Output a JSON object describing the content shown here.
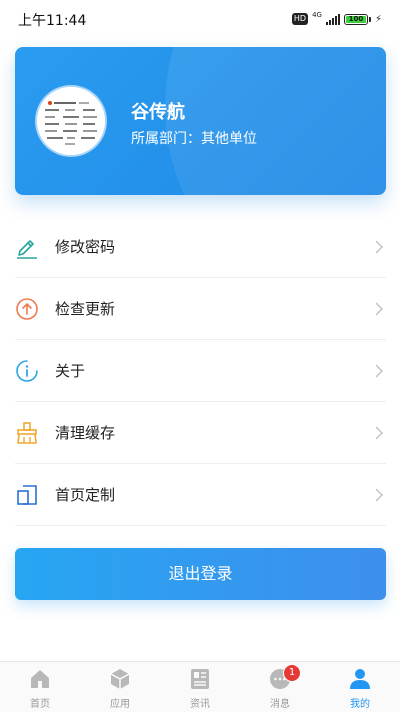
{
  "status_bar": {
    "time": "上午11:44",
    "hd": "HD",
    "network": "4G",
    "battery": "100"
  },
  "profile": {
    "name": "谷传航",
    "department": "所属部门：其他单位"
  },
  "menu": {
    "items": [
      {
        "label": "修改密码",
        "icon": "pencil-icon",
        "color": "#26a69a"
      },
      {
        "label": "检查更新",
        "icon": "upload-arrow-icon",
        "color": "#f07a50"
      },
      {
        "label": "关于",
        "icon": "info-icon",
        "color": "#2ba5e8"
      },
      {
        "label": "清理缓存",
        "icon": "broom-icon",
        "color": "#f0a830"
      },
      {
        "label": "首页定制",
        "icon": "layout-icon",
        "color": "#2a6fd6"
      }
    ]
  },
  "logout": {
    "label": "退出登录"
  },
  "tabbar": {
    "tabs": [
      {
        "label": "首页",
        "icon": "home-icon"
      },
      {
        "label": "应用",
        "icon": "cube-icon"
      },
      {
        "label": "资讯",
        "icon": "news-icon"
      },
      {
        "label": "消息",
        "icon": "chat-icon",
        "badge": "1"
      },
      {
        "label": "我的",
        "icon": "user-icon",
        "active": true
      }
    ]
  },
  "colors": {
    "accent": "#2196f3",
    "badge": "#e53935"
  }
}
